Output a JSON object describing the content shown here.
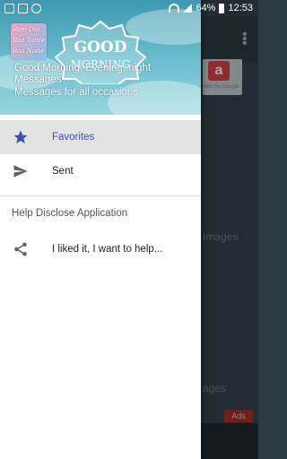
{
  "status_bar": {
    "battery": "64%",
    "time": "12:53"
  },
  "background": {
    "label_1": "Images",
    "label_2": "ages",
    "ad_small": "Ads by Google",
    "ads_button": "Ads"
  },
  "header": {
    "title": "Good Morning, Evening, night Messages",
    "subtitle": "Messages for all occasions",
    "badge_line1": "GOOD",
    "badge_line2": "MORNING",
    "avatar_lines": [
      "Bom Dia",
      "Boa Tarde",
      "Boa Noite"
    ]
  },
  "menu": {
    "items": [
      {
        "label": "Favorites",
        "icon": "star-icon",
        "active": true
      },
      {
        "label": "Sent",
        "icon": "send-icon",
        "active": false
      }
    ],
    "section_title": "Help Disclose Application",
    "share_item": {
      "label": "I liked it, I want to help...",
      "icon": "share-icon"
    }
  },
  "colors": {
    "accent": "#3f51b5",
    "active_bg": "#e3e3e3"
  }
}
